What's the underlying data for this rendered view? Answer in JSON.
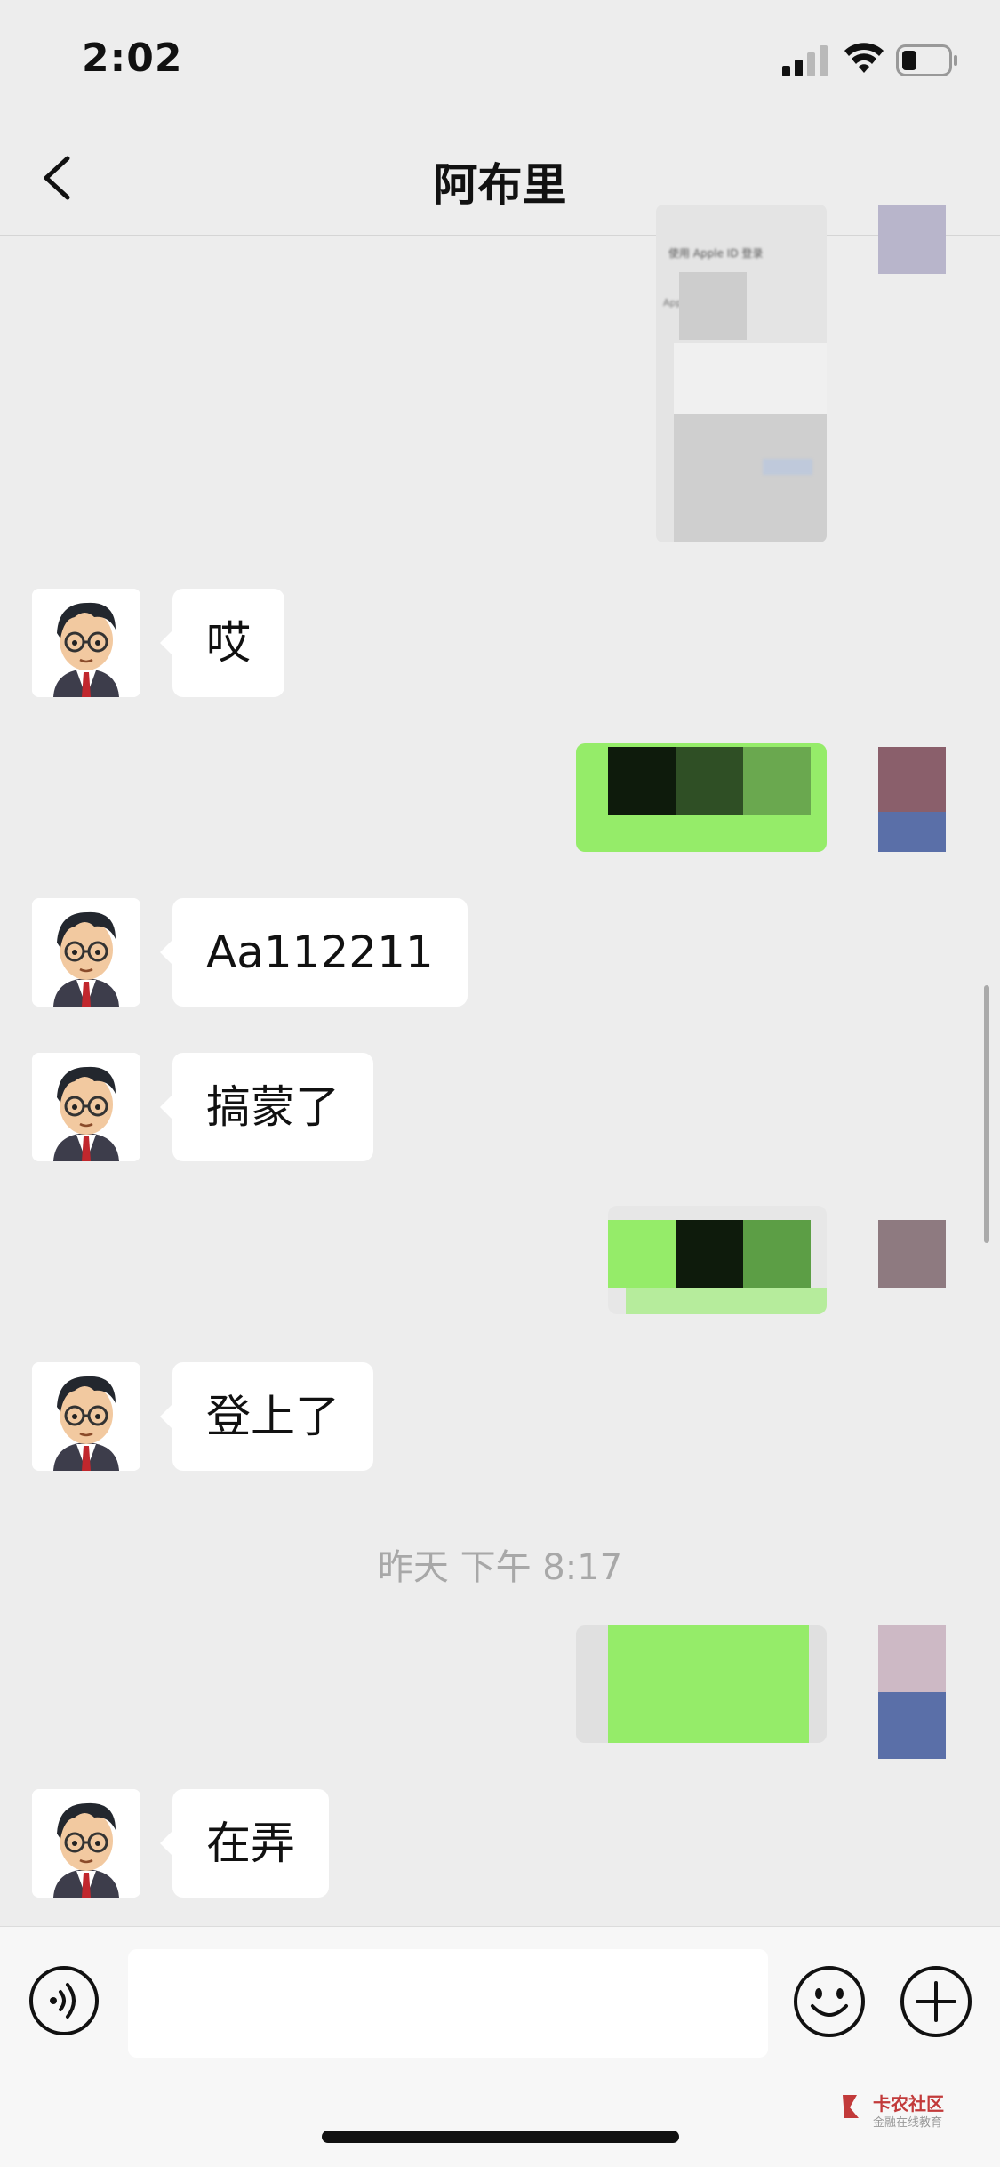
{
  "status_bar": {
    "time": "2:02"
  },
  "header": {
    "title": "阿布里"
  },
  "messages": {
    "m1": "哎",
    "m2": "Aa112211",
    "m3": "搞蒙了",
    "m4": "登上了",
    "m5": "在弄"
  },
  "screenshot_text": {
    "line1": "使用 Apple ID 登录",
    "line2": "Apple ID"
  },
  "timestamp": "昨天 下午 8:17",
  "input": {
    "placeholder": ""
  },
  "watermark": {
    "name": "卡农社区",
    "tagline": "金融在线教育"
  },
  "colors": {
    "background": "#ededed",
    "outgoing": "#95ec69",
    "incoming": "#ffffff"
  }
}
